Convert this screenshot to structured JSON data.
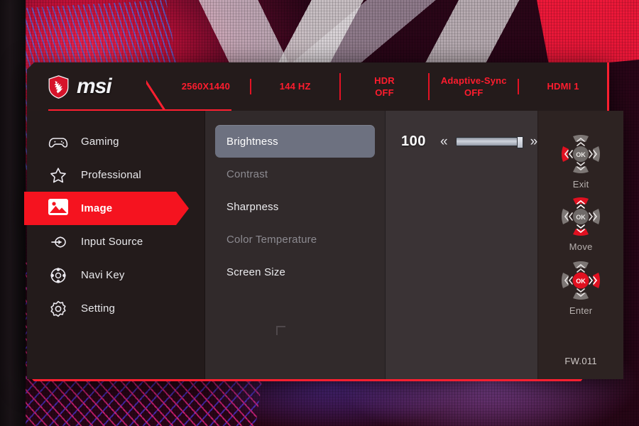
{
  "header": {
    "logo_name": "msi-logo",
    "logo_text": "msi",
    "stats": [
      {
        "name": "resolution",
        "line1": "2560X1440",
        "line2": ""
      },
      {
        "name": "refresh-rate",
        "line1": "144 HZ",
        "line2": ""
      },
      {
        "name": "hdr-status",
        "line1": "HDR",
        "line2": "OFF"
      },
      {
        "name": "adaptive-sync-status",
        "line1": "Adaptive-Sync",
        "line2": "OFF"
      },
      {
        "name": "input-source",
        "line1": "HDMI 1",
        "line2": ""
      }
    ]
  },
  "sidebar": {
    "items": [
      {
        "label": "Gaming",
        "icon": "gamepad-icon",
        "active": false
      },
      {
        "label": "Professional",
        "icon": "star-icon",
        "active": false
      },
      {
        "label": "Image",
        "icon": "image-icon",
        "active": true
      },
      {
        "label": "Input Source",
        "icon": "input-arrow-icon",
        "active": false
      },
      {
        "label": "Navi Key",
        "icon": "navi-key-icon",
        "active": false
      },
      {
        "label": "Setting",
        "icon": "gear-icon",
        "active": false
      }
    ]
  },
  "submenu": {
    "items": [
      {
        "label": "Brightness",
        "state": "selected"
      },
      {
        "label": "Contrast",
        "state": "disabled"
      },
      {
        "label": "Sharpness",
        "state": "normal"
      },
      {
        "label": "Color Temperature",
        "state": "disabled"
      },
      {
        "label": "Screen Size",
        "state": "normal"
      }
    ]
  },
  "value_panel": {
    "value": "100",
    "decrease_glyph": "«",
    "increase_glyph": "»",
    "slider_percent": 100
  },
  "navkeys": {
    "groups": [
      {
        "label": "Exit",
        "active": [
          "left"
        ]
      },
      {
        "label": "Move",
        "active": [
          "up",
          "down"
        ]
      },
      {
        "label": "Enter",
        "active": [
          "right",
          "ok"
        ]
      }
    ],
    "ok_label": "OK",
    "firmware": "FW.011"
  },
  "colors": {
    "accent_red": "#ff1f30",
    "highlight_red": "#f5131f",
    "stat_red": "#ff1c2e",
    "panel_dark": "#231b1b",
    "panel_mid": "#312a2b",
    "panel_value": "#3a3335",
    "selected_gray": "#6d7180"
  }
}
